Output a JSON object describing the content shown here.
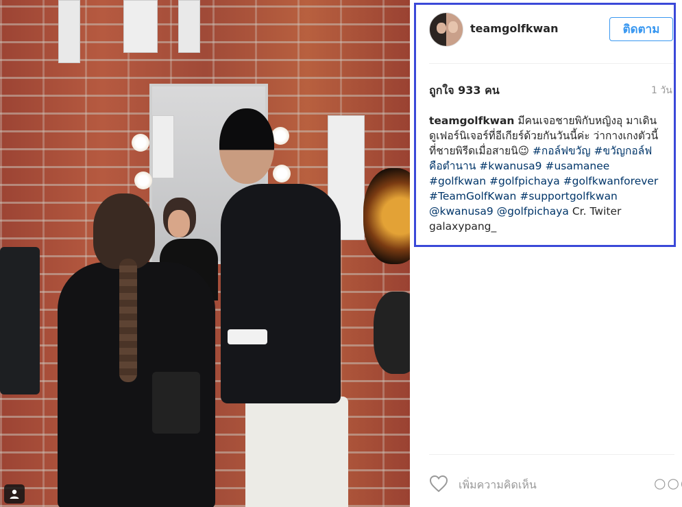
{
  "post": {
    "username": "teamgolfkwan",
    "follow_label": "ติดตาม",
    "likes": "ถูกใจ 933 คน",
    "time": "1 วัน",
    "caption": {
      "username": "teamgolfkwan",
      "text": "มีคนเจอชายพิกับหญิงอุ มาเดินดูเฟอร์นิเจอร์ที่อีเกียร์ด้วยกันวันนี้ค่ะ ว่ากางเกงตัวนี้ที่ชายพิรีดเมื่อสายนิ😉",
      "tags": [
        "#กอล์ฟขวัญ",
        "#ขวัญกอล์ฟคือตำนาน",
        "#kwanusa9",
        "#usamanee",
        "#golfkwan",
        "#golfpichaya",
        "#golfkwanforever",
        "#TeamGolfKwan",
        "#supportgolfkwan",
        "@kwanusa9",
        "@golfpichaya"
      ],
      "credit": "Cr. Twiter galaxypang_"
    },
    "comment_placeholder": "เพิ่มความคิดเห็น",
    "more_label": "○○○"
  },
  "colors": {
    "accent": "#3897f0",
    "highlight_border": "#3a48d8",
    "tag_color": "#003569"
  }
}
